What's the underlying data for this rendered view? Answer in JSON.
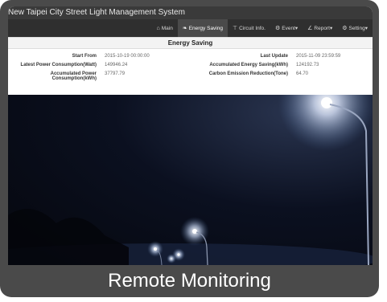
{
  "app": {
    "title": "New Taipei City Street Light Management System"
  },
  "nav": {
    "items": [
      {
        "label": "Main",
        "icon": "home-icon",
        "glyph": "⌂"
      },
      {
        "label": "Energy Saving",
        "icon": "leaf-icon",
        "glyph": "❧"
      },
      {
        "label": "Circuit Info.",
        "icon": "circuit-icon",
        "glyph": "⊤"
      },
      {
        "label": "Event",
        "icon": "cogs-icon",
        "glyph": "⚙"
      },
      {
        "label": "Report",
        "icon": "chart-icon",
        "glyph": "∠"
      },
      {
        "label": "Setting",
        "icon": "cogs-icon",
        "glyph": "⚙"
      }
    ],
    "active": "Energy Saving"
  },
  "panel": {
    "title": "Energy Saving",
    "rows": {
      "start_from_label": "Start From",
      "start_from_value": "2015-10-19 00:00:00",
      "last_update_label": "Last Update",
      "last_update_value": "2015-11-09 23:59:59",
      "latest_power_label": "Latest Power Consumption(Watt)",
      "latest_power_value": "149946.24",
      "acc_energy_saving_label": "Accumulated Energy Saving(kWh)",
      "acc_energy_saving_value": "124192.73",
      "acc_power_label_1": "Accumulated Power",
      "acc_power_label_2": "Consumption(kWh)",
      "acc_power_value": "37797.79",
      "carbon_label": "Carbon Emission Reduction(Tone)",
      "carbon_value": "64.70"
    }
  },
  "caption": "Remote Monitoring",
  "colors": {
    "frame": "#4a4a4a",
    "navbar": "#2f2f2f",
    "titlebar": "#3a3a3a"
  }
}
